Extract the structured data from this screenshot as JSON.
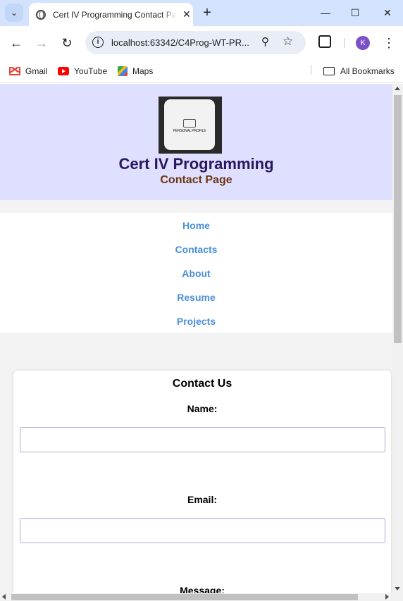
{
  "browser": {
    "tab_title": "Cert IV Programming Contact Page",
    "tab_close": "✕",
    "new_tab": "+",
    "win_min": "—",
    "win_max": "☐",
    "win_close": "✕",
    "url": "localhost:63342/C4Prog-WT-PR...",
    "avatar_letter": "K",
    "bookmarks": [
      "Gmail",
      "YouTube",
      "Maps"
    ],
    "all_bookmarks": "All Bookmarks"
  },
  "header": {
    "logo_text": "PERSONAL PROFILE",
    "title": "Cert IV Programming",
    "subtitle": "Contact Page"
  },
  "nav": {
    "links": [
      "Home",
      "Contacts",
      "About",
      "Resume",
      "Projects"
    ]
  },
  "contact": {
    "heading": "Contact Us",
    "name_label": "Name:",
    "email_label": "Email:",
    "message_label": "Message:",
    "name_value": "",
    "email_value": ""
  },
  "colors": {
    "header_bg": "#dfdfff",
    "title": "#2a1760",
    "subtitle": "#6b3410",
    "nav_link": "#4a90d9"
  }
}
